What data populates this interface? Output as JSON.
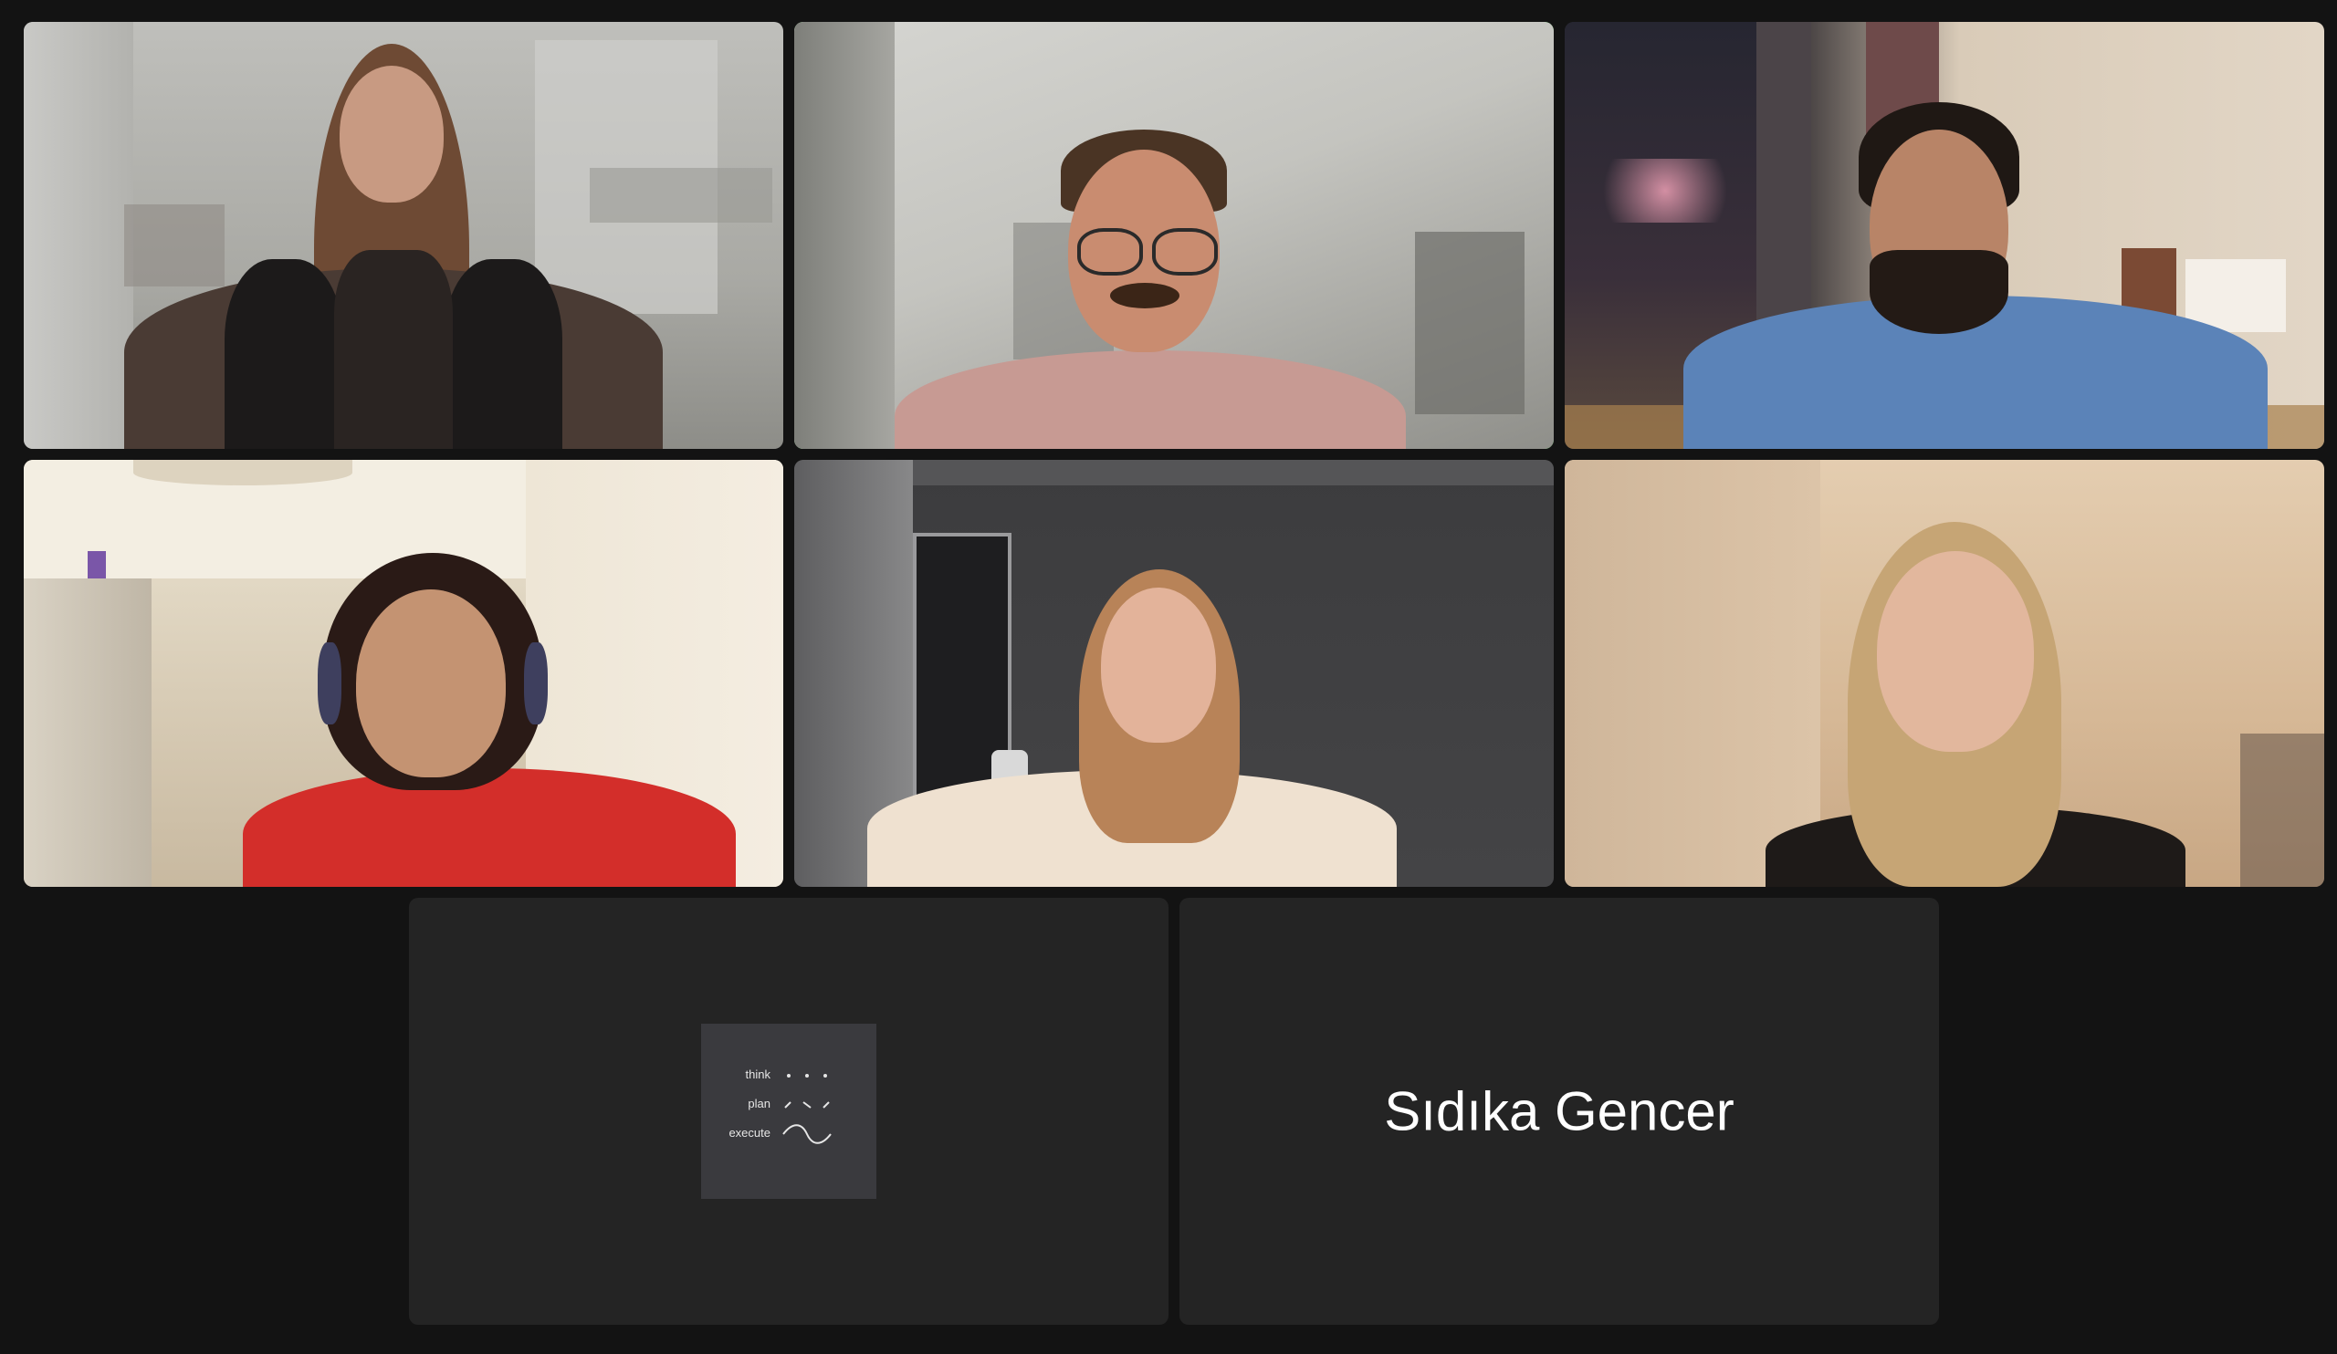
{
  "meeting": {
    "active_speaker_color": "#3fd14b",
    "background_color": "#131313",
    "tile_color": "#242424"
  },
  "participants": [
    {
      "id": "p1",
      "video": "on",
      "description_icon": "video-feed"
    },
    {
      "id": "p2",
      "video": "on",
      "active_speaker": true
    },
    {
      "id": "p3",
      "video": "on"
    },
    {
      "id": "p4",
      "video": "on"
    },
    {
      "id": "p5",
      "video": "on"
    },
    {
      "id": "p6",
      "video": "on"
    },
    {
      "id": "p7",
      "video": "off",
      "avatar": {
        "type": "logo",
        "words": [
          "think",
          "plan",
          "execute"
        ]
      }
    },
    {
      "id": "p8",
      "video": "off",
      "name": "Sıdıka Gencer"
    }
  ]
}
